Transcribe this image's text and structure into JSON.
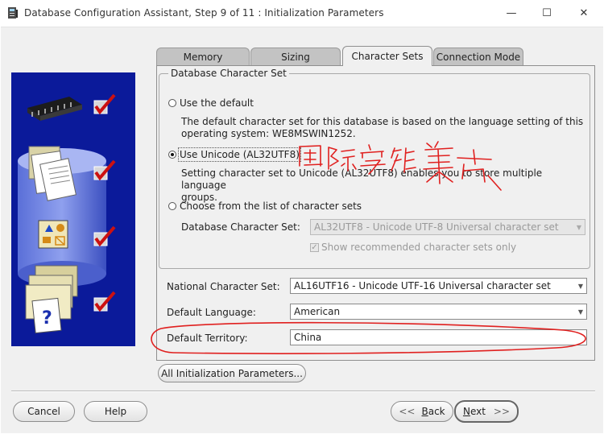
{
  "window": {
    "title": "Database Configuration Assistant, Step 9 of 11 : Initialization Parameters",
    "minimize_glyph": "—",
    "maximize_glyph": "☐",
    "close_glyph": "✕"
  },
  "tabs": [
    {
      "label": "Memory",
      "active": false
    },
    {
      "label": "Sizing",
      "active": false
    },
    {
      "label": "Character Sets",
      "active": true
    },
    {
      "label": "Connection Mode",
      "active": false
    }
  ],
  "db_charset_group": {
    "legend": "Database Character Set",
    "options": [
      {
        "label": "Use the default",
        "selected": false,
        "description_lines": [
          "The default character set for this database is based on the language setting of this",
          "operating system: WE8MSWIN1252."
        ]
      },
      {
        "label": "Use Unicode (AL32UTF8)",
        "selected": true,
        "description_lines": [
          "Setting character set to Unicode (AL32UTF8) enables you to store multiple language",
          "groups."
        ]
      },
      {
        "label": "Choose from the list of character sets",
        "selected": false
      }
    ],
    "charset_label": "Database Character Set:",
    "charset_value": "AL32UTF8 - Unicode UTF-8 Universal character set",
    "show_recommended_label": "Show recommended character sets only",
    "show_recommended_checked": true
  },
  "national_charset": {
    "label": "National Character Set:",
    "value": "AL16UTF16 - Unicode UTF-16 Universal character set"
  },
  "default_language": {
    "label": "Default Language:",
    "value": "American"
  },
  "default_territory": {
    "label": "Default Territory:",
    "value": "China"
  },
  "all_params_button": "All Initialization Parameters...",
  "footer": {
    "cancel": "Cancel",
    "help": "Help",
    "back_prefix": "",
    "back_mnemonic": "B",
    "back_rest": "ack",
    "next_mnemonic": "N",
    "next_rest": "ext"
  },
  "side_art": {
    "steps_checked": [
      true,
      true,
      true,
      true
    ],
    "colors": {
      "background": "#0b1a9a",
      "check": "#cc1111",
      "folder": "#e8e0b0"
    }
  },
  "icons": [
    "app-icon",
    "radio-icon",
    "dropdown-arrow-icon",
    "checkbox-icon",
    "back-arrow-icon",
    "next-arrow-icon",
    "checkmark-icon",
    "chip-icon",
    "document-icon",
    "shapes-icon",
    "question-icon"
  ],
  "colors": {
    "annotation": "#e0201f"
  }
}
